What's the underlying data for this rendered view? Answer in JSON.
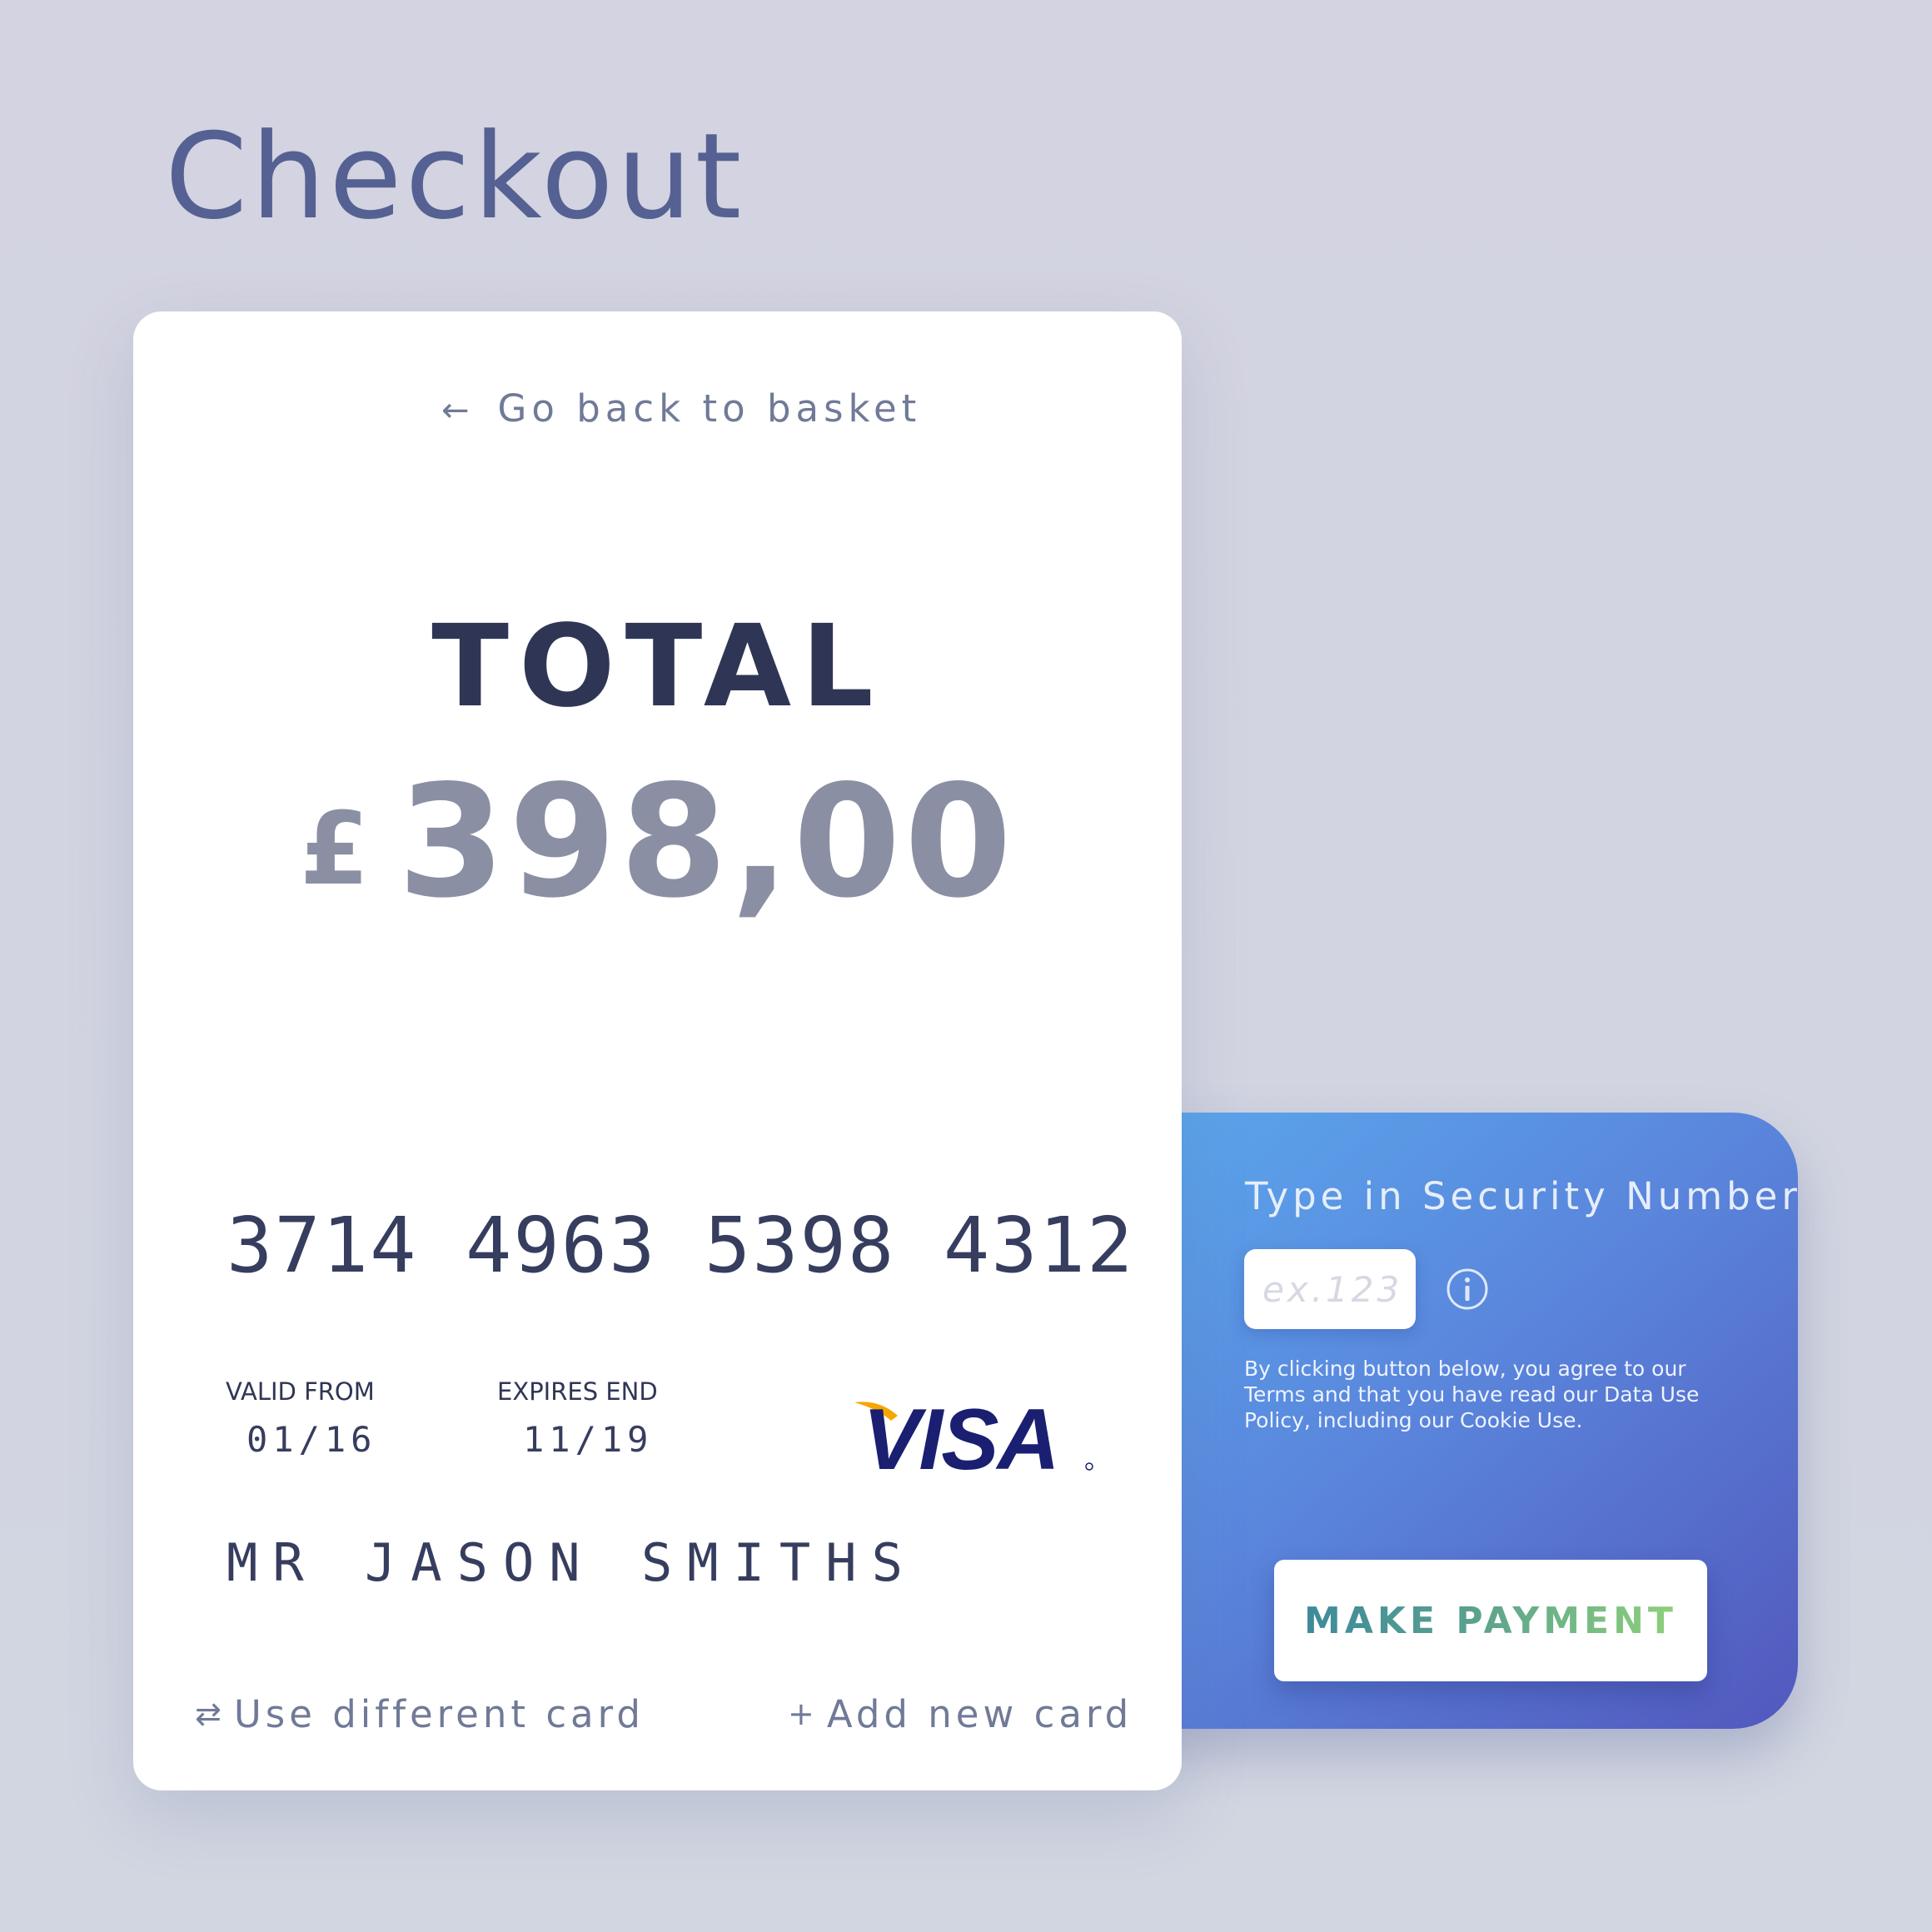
{
  "page": {
    "title": "Checkout"
  },
  "card_panel": {
    "back_link": {
      "icon": "arrow-left-icon",
      "label": "Go back to basket"
    },
    "total_label": "TOTAL",
    "currency_symbol": "£",
    "amount": "398,00",
    "card_number": "3714 4963 5398 4312",
    "valid_from": {
      "label": "VALID FROM",
      "value": "01/16"
    },
    "expires_end": {
      "label": "EXPIRES END",
      "value": "11/19"
    },
    "card_brand": "VISA",
    "cardholder_name": "MR JASON SMITHS",
    "use_different_card": {
      "icon": "swap-arrows-icon",
      "label": "Use different card"
    },
    "add_new_card": {
      "icon": "plus-icon",
      "label": "Add new card"
    }
  },
  "security_panel": {
    "label": "Type in Security Number",
    "input_value": "",
    "input_placeholder": "ex.123",
    "info_icon": "info-icon",
    "legal_text": "By clicking button below, you agree to our Terms and that you have read our Data Use Policy, including our Cookie Use.",
    "button_label": "MAKE PAYMENT"
  },
  "colors": {
    "title": "#556192",
    "primary_text": "#2f3655",
    "muted_text": "#8a8fa3",
    "panel_gradient_start": "#5aa7ec",
    "panel_gradient_end": "#5258bd",
    "button_text_start": "#3d8a9c",
    "button_text_end": "#8ed07a",
    "visa_blue": "#1a1f71",
    "visa_gold": "#f7a600"
  }
}
